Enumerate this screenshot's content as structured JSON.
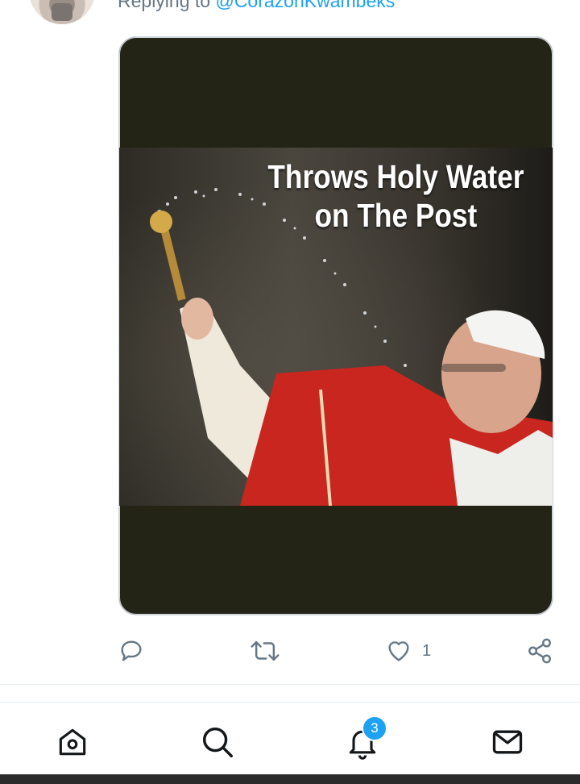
{
  "reply": {
    "prefix": "Replying to",
    "handle": "@CorazonKwambeks"
  },
  "media": {
    "caption_line1": "Throws Holy Water",
    "caption_line2": "on The Post",
    "alt": "Meme: pope sprinkling holy water"
  },
  "actions": {
    "reply_icon": "reply-icon",
    "retweet_icon": "retweet-icon",
    "like_icon": "heart-icon",
    "like_count": "1",
    "share_icon": "share-icon"
  },
  "tabbar": {
    "items": [
      {
        "name": "home",
        "icon": "home-icon"
      },
      {
        "name": "search",
        "icon": "search-icon"
      },
      {
        "name": "notifications",
        "icon": "bell-icon",
        "badge": "3"
      },
      {
        "name": "messages",
        "icon": "mail-icon"
      }
    ]
  },
  "colors": {
    "accent": "#1da1f2",
    "icon_gray": "#657786",
    "tab_icon": "#14171a",
    "media_bg": "#232316"
  }
}
